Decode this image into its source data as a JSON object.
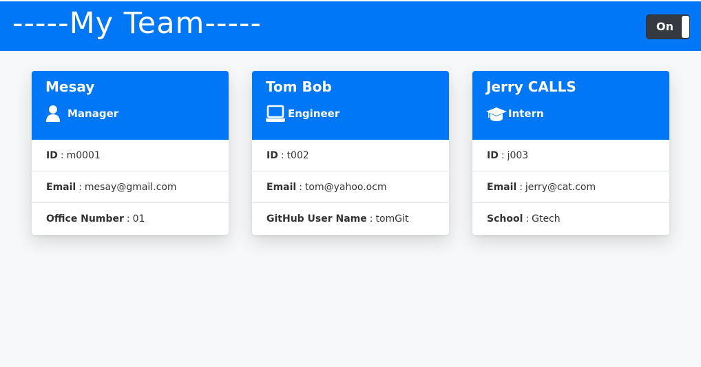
{
  "header": {
    "title": "-----My Team-----",
    "toggle_label": "On",
    "background_color": "#0077f7"
  },
  "cards": [
    {
      "name": "Mesay",
      "role": "Manager",
      "role_icon": "user-icon",
      "fields": [
        {
          "label": "ID",
          "value": "m0001"
        },
        {
          "label": "Email",
          "value": "mesay@gmail.com"
        },
        {
          "label": "Office Number",
          "value": "01"
        }
      ]
    },
    {
      "name": "Tom Bob",
      "role": "Engineer",
      "role_icon": "laptop-icon",
      "fields": [
        {
          "label": "ID",
          "value": "t002"
        },
        {
          "label": "Email",
          "value": "tom@yahoo.ocm"
        },
        {
          "label": "GitHub User Name",
          "value": "tomGit"
        }
      ]
    },
    {
      "name": "Jerry CALLS",
      "role": "Intern",
      "role_icon": "graduation-cap-icon",
      "fields": [
        {
          "label": "ID",
          "value": "j003"
        },
        {
          "label": "Email",
          "value": "jerry@cat.com"
        },
        {
          "label": "School",
          "value": "Gtech"
        }
      ]
    }
  ]
}
